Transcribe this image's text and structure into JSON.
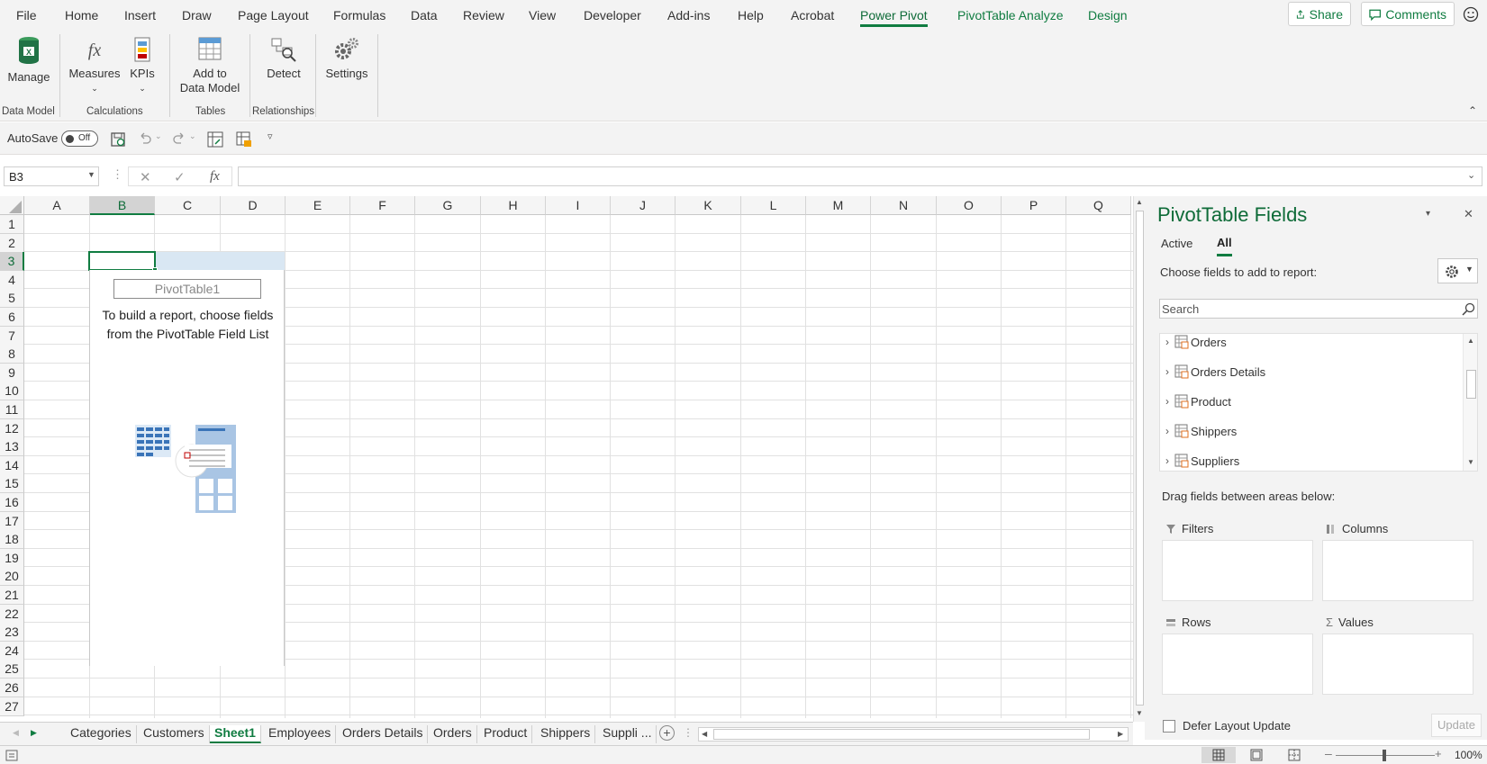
{
  "menu": {
    "items": [
      "File",
      "Home",
      "Insert",
      "Draw",
      "Page Layout",
      "Formulas",
      "Data",
      "Review",
      "View",
      "Developer",
      "Add-ins",
      "Help",
      "Acrobat",
      "Power Pivot",
      "PivotTable Analyze",
      "Design"
    ],
    "active": "Power Pivot",
    "share_label": "Share",
    "comments_label": "Comments"
  },
  "ribbon": {
    "buttons": {
      "manage": "Manage",
      "measures": "Measures",
      "kpis": "KPIs",
      "add_to_data_model_1": "Add to",
      "add_to_data_model_2": "Data Model",
      "detect": "Detect",
      "settings": "Settings"
    },
    "groups": {
      "data_model": "Data Model",
      "calculations": "Calculations",
      "tables": "Tables",
      "relationships": "Relationships"
    }
  },
  "qat": {
    "autosave_label": "AutoSave",
    "autosave_state": "Off"
  },
  "formula_bar": {
    "name_box": "B3",
    "fx": "fx",
    "formula": ""
  },
  "grid": {
    "columns": [
      "A",
      "B",
      "C",
      "D",
      "E",
      "F",
      "G",
      "H",
      "I",
      "J",
      "K",
      "L",
      "M",
      "N",
      "O",
      "P",
      "Q"
    ],
    "rows": [
      "1",
      "2",
      "3",
      "4",
      "5",
      "6",
      "7",
      "8",
      "9",
      "10",
      "11",
      "12",
      "13",
      "14",
      "15",
      "16",
      "17",
      "18",
      "19",
      "20",
      "21",
      "22",
      "23",
      "24",
      "25",
      "26",
      "27"
    ],
    "selected_cell": "B3"
  },
  "pivot_placeholder": {
    "name": "PivotTable1",
    "line1": "To build a report, choose fields",
    "line2": "from the PivotTable Field List"
  },
  "pivot_pane": {
    "title": "PivotTable Fields",
    "tab_active": "Active",
    "tab_all": "All",
    "choose_label": "Choose fields to add to report:",
    "search_placeholder": "Search",
    "tables": [
      "Orders",
      "Orders Details",
      "Product",
      "Shippers",
      "Suppliers"
    ],
    "drag_label": "Drag fields between areas below:",
    "areas": {
      "filters": "Filters",
      "columns": "Columns",
      "rows": "Rows",
      "values": "Values"
    },
    "defer_label": "Defer Layout Update",
    "update_label": "Update"
  },
  "sheet_tabs": {
    "tabs": [
      "Categories",
      "Customers",
      "Sheet1",
      "Employees",
      "Orders Details",
      "Orders",
      "Product",
      "Shippers",
      "Suppli ..."
    ],
    "active": "Sheet1"
  },
  "status": {
    "zoom": "100%"
  },
  "colors": {
    "accent": "#107c41",
    "accent_dark": "#0e6b38"
  }
}
